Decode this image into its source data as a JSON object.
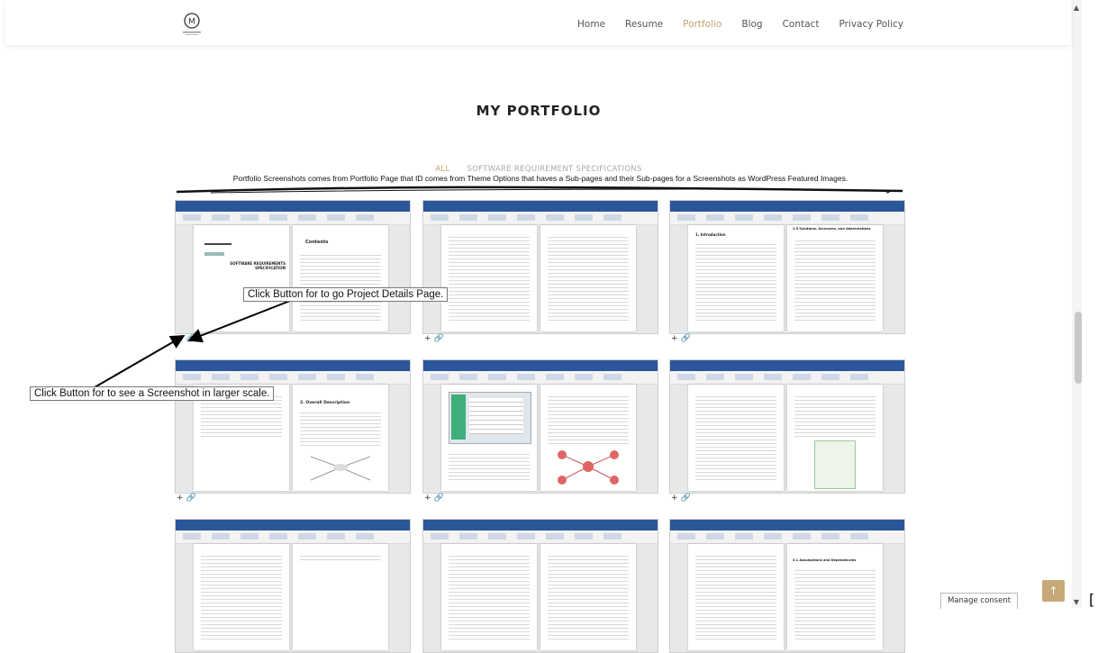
{
  "header": {
    "nav": [
      "Home",
      "Resume",
      "Portfolio",
      "Blog",
      "Contact",
      "Privacy Policy"
    ],
    "active_nav": "Portfolio",
    "logo_text": "M"
  },
  "main": {
    "title": "MY PORTFOLIO",
    "filters": [
      "ALL",
      "SOFTWARE REQUIREMENT SPECIFICATIONS"
    ],
    "active_filter": "ALL",
    "description": "Portfolio Screenshots comes from Portfolio Page that ID comes from Theme Options that haves a Sub-pages and their Sub-pages for a Screenshots as WordPress Featured Images."
  },
  "callouts": {
    "project_details": "Click Button for to go Project Details Page.",
    "larger_scale": "Click Button for to see a Screenshot in larger scale."
  },
  "card_icons": {
    "zoom": "+",
    "link": "🔗"
  },
  "cards": [
    {
      "left_heading": "SOFTWARE REQUIREMENTS SPECIFICATION",
      "right_heading": "Contents"
    },
    {
      "left_heading": "",
      "right_heading": ""
    },
    {
      "left_heading": "1. Introduction",
      "right_heading": "2.5 Solutions, Acronyms, and Abbreviations"
    },
    {
      "left_heading": "",
      "right_heading": "2. Overall Description"
    },
    {
      "left_heading": "",
      "right_heading": ""
    },
    {
      "left_heading": "",
      "right_heading": ""
    },
    {
      "left_heading": "",
      "right_heading": ""
    },
    {
      "left_heading": "",
      "right_heading": ""
    },
    {
      "left_heading": "",
      "right_heading": "3.1 Assumptions and Dependencies"
    }
  ],
  "footer": {
    "consent": "Manage consent",
    "back_to_top": "↑",
    "edge_glyph": "["
  },
  "colors": {
    "accent": "#c2a472",
    "word_ribbon": "#2b579a",
    "back_to_top_bg": "#c7a878"
  }
}
